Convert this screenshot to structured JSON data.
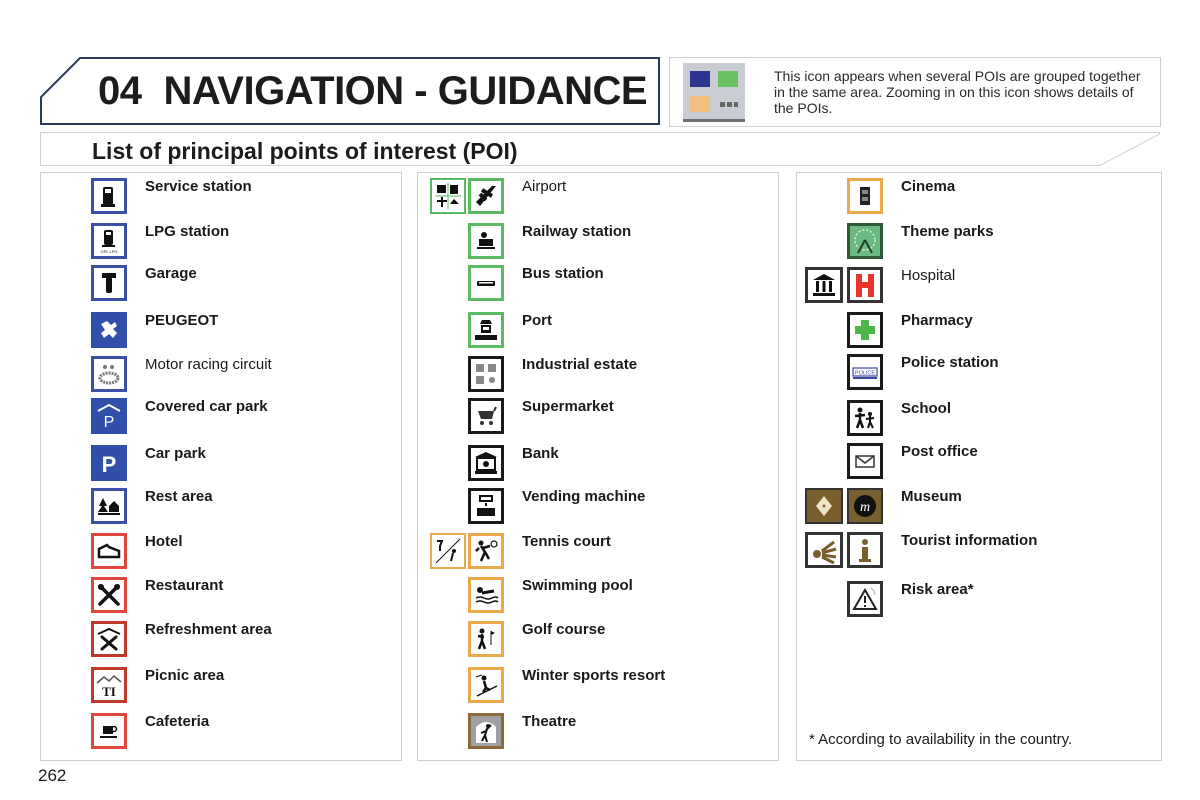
{
  "header": {
    "chapter_number": "04",
    "chapter_title": "NAVIGATION - GUIDANCE",
    "info_text": "This icon appears when several POIs are grouped together in the same area. Zooming in on this icon shows details of the POIs.",
    "group_icon": "grouped-poi-icon"
  },
  "subtitle": "List of principal points of interest (POI)",
  "columns": [
    {
      "items": [
        {
          "label": "Service station",
          "icon": "fuel-pump-icon"
        },
        {
          "label": "LPG station",
          "icon": "lpg-pump-icon"
        },
        {
          "label": "Garage",
          "icon": "spanner-icon"
        },
        {
          "label": "PEUGEOT",
          "icon": "peugeot-lion-icon"
        },
        {
          "label": "Motor racing circuit",
          "icon": "racing-circuit-icon"
        },
        {
          "label": "Covered car park",
          "icon": "covered-parking-icon"
        },
        {
          "label": "Car park",
          "icon": "parking-icon"
        },
        {
          "label": "Rest area",
          "icon": "rest-area-icon"
        },
        {
          "label": "Hotel",
          "icon": "bed-icon"
        },
        {
          "label": "Restaurant",
          "icon": "fork-knife-icon"
        },
        {
          "label": "Refreshment area",
          "icon": "refreshment-icon"
        },
        {
          "label": "Picnic area",
          "icon": "picnic-icon"
        },
        {
          "label": "Cafeteria",
          "icon": "coffee-cup-icon"
        }
      ]
    },
    {
      "items": [
        {
          "label": "Airport",
          "icon": "airplane-icon",
          "group_icon": "transport-group-icon"
        },
        {
          "label": "Railway station",
          "icon": "train-icon"
        },
        {
          "label": "Bus station",
          "icon": "bus-icon"
        },
        {
          "label": "Port",
          "icon": "ship-icon"
        },
        {
          "label": "Industrial estate",
          "icon": "industrial-icon"
        },
        {
          "label": "Supermarket",
          "icon": "shopping-cart-icon"
        },
        {
          "label": "Bank",
          "icon": "bank-icon"
        },
        {
          "label": "Vending machine",
          "icon": "vending-machine-icon"
        },
        {
          "label": "Tennis court",
          "icon": "tennis-icon",
          "group_icon": "sport-leisure-group-icon"
        },
        {
          "label": "Swimming pool",
          "icon": "swimmer-icon"
        },
        {
          "label": "Golf course",
          "icon": "golfer-icon"
        },
        {
          "label": "Winter sports resort",
          "icon": "skier-icon"
        },
        {
          "label": "Theatre",
          "icon": "theatre-icon"
        }
      ]
    },
    {
      "items": [
        {
          "label": "Cinema",
          "icon": "film-icon"
        },
        {
          "label": "Theme parks",
          "icon": "ferris-wheel-icon"
        },
        {
          "label": "Hospital",
          "icon": "hospital-h-icon",
          "group_icon": "public-building-group-icon"
        },
        {
          "label": "Pharmacy",
          "icon": "green-cross-icon"
        },
        {
          "label": "Police station",
          "icon": "police-icon"
        },
        {
          "label": "School",
          "icon": "children-icon"
        },
        {
          "label": "Post office",
          "icon": "envelope-icon"
        },
        {
          "label": "Museum",
          "icon": "museum-m-icon",
          "group_icon": "monument-group-icon"
        },
        {
          "label": "Tourist information",
          "icon": "info-i-icon",
          "group_icon": "tourism-group-icon"
        },
        {
          "label": "Risk area*",
          "icon": "warning-triangle-icon"
        }
      ],
      "footnote": "* According to availability in the country."
    }
  ],
  "page_number": "262",
  "colors": {
    "car_services": "#3a4fa8",
    "food_lodging": "#e0473c",
    "transport": "#5cba62",
    "commerce": "#1a1a1a",
    "leisure": "#eba94e",
    "heading_border": "#2a3a5a"
  }
}
